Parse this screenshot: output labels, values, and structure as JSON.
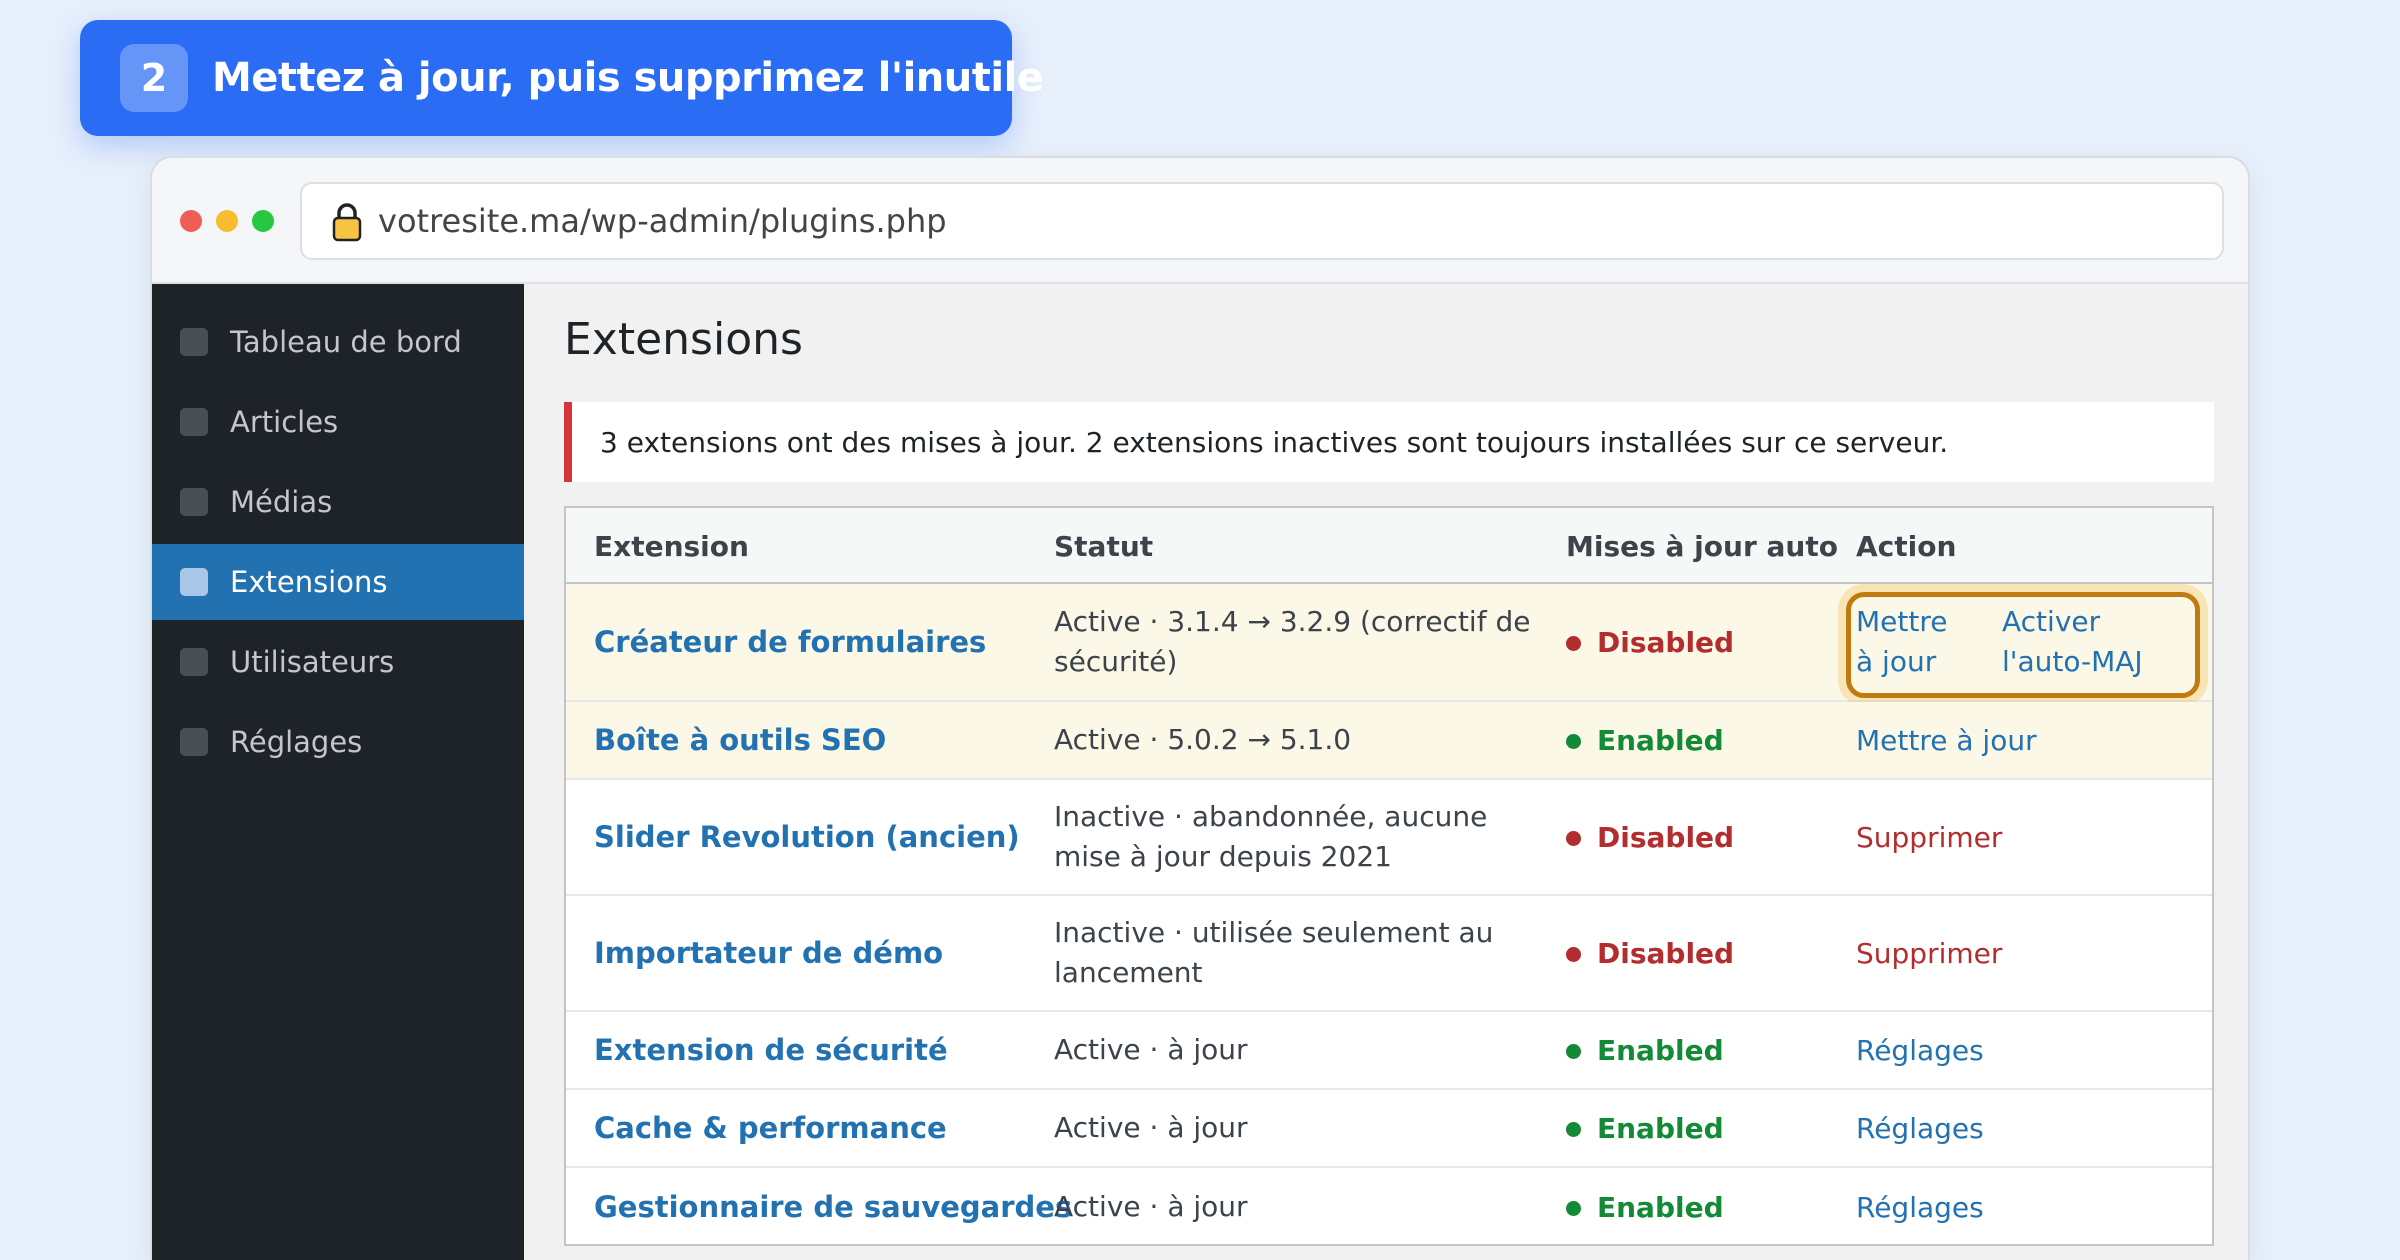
{
  "banner": {
    "step": "2",
    "title": "Mettez à jour, puis supprimez l'inutile"
  },
  "browser": {
    "url": "votresite.ma/wp-admin/plugins.php"
  },
  "sidebar": {
    "items": [
      {
        "label": "Tableau de bord",
        "active": false
      },
      {
        "label": "Articles",
        "active": false
      },
      {
        "label": "Médias",
        "active": false
      },
      {
        "label": "Extensions",
        "active": true
      },
      {
        "label": "Utilisateurs",
        "active": false
      },
      {
        "label": "Réglages",
        "active": false
      }
    ]
  },
  "main": {
    "title": "Extensions",
    "notice": "3 extensions ont des mises à jour. 2 extensions inactives sont toujours installées sur ce serveur."
  },
  "table": {
    "headers": [
      "Extension",
      "Statut",
      "Mises à jour auto",
      "Action"
    ],
    "rows": [
      {
        "name": "Créateur de formulaires",
        "status": "Active · 3.1.4 → 3.2.9 (correctif de sécurité)",
        "auto": "Disabled",
        "action": "Mettre à jour",
        "action2": "Activer l'auto-MAJ"
      },
      {
        "name": "Boîte à outils SEO",
        "status": "Active · 5.0.2 → 5.1.0",
        "auto": "Enabled",
        "action": "Mettre à jour"
      },
      {
        "name": "Slider Revolution (ancien)",
        "status": "Inactive · abandonnée, aucune mise à jour depuis 2021",
        "auto": "Disabled",
        "action": "Supprimer"
      },
      {
        "name": "Importateur de démo",
        "status": "Inactive · utilisée seulement au lancement",
        "auto": "Disabled",
        "action": "Supprimer"
      },
      {
        "name": "Extension de sécurité",
        "status": "Active · à jour",
        "auto": "Enabled",
        "action": "Réglages"
      },
      {
        "name": "Cache & performance",
        "status": "Active · à jour",
        "auto": "Enabled",
        "action": "Réglages"
      },
      {
        "name": "Gestionnaire de sauvegardes",
        "status": "Active · à jour",
        "auto": "Enabled",
        "action": "Réglages"
      }
    ]
  },
  "colors": {
    "accent": "#2a6cf4",
    "wp_blue": "#2271b1",
    "enabled": "#138a36",
    "disabled": "#b32d2e",
    "highlight_row": "#fcf8e8",
    "sidebar": "#1e2327"
  }
}
